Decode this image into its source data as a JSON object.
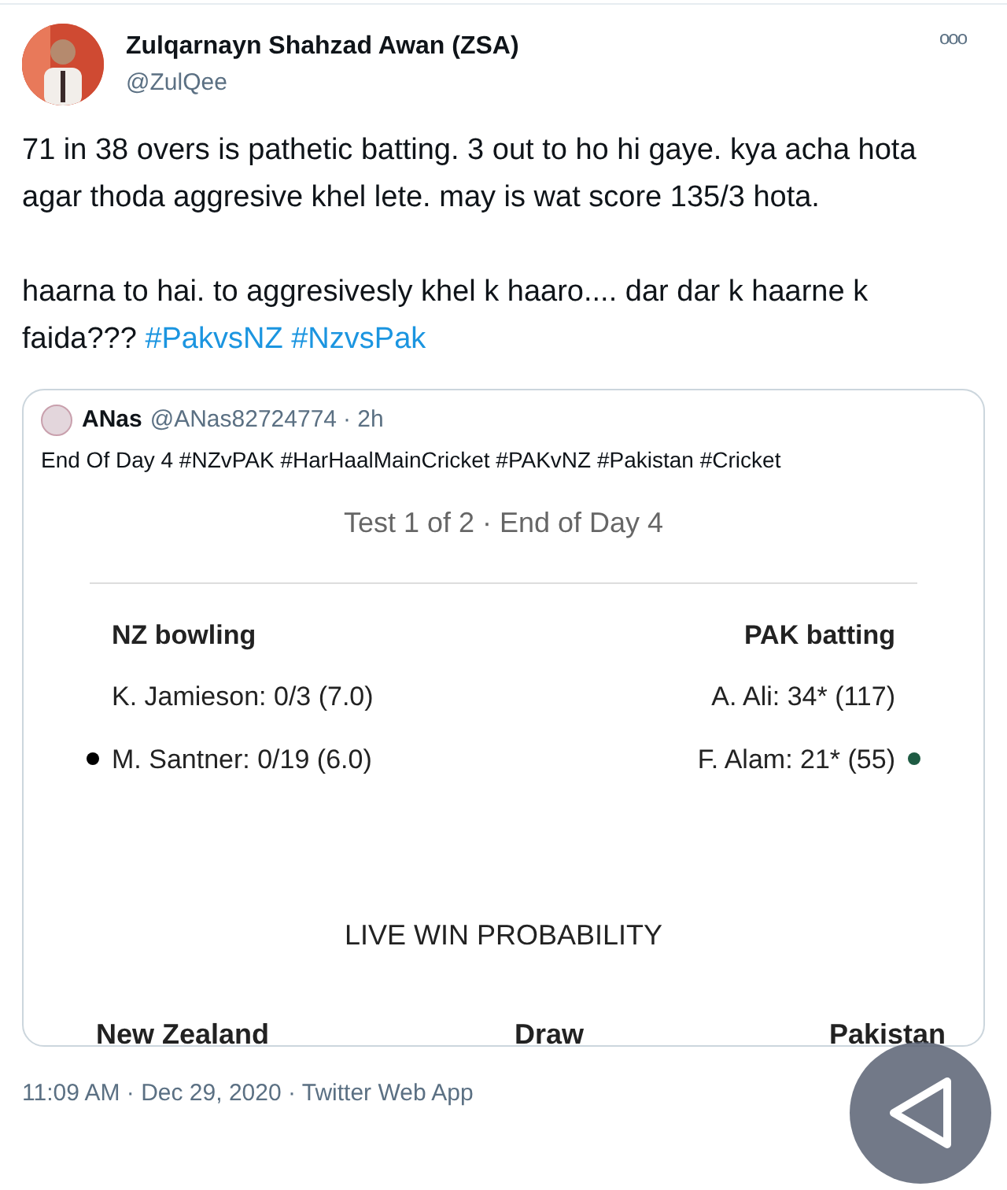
{
  "author": {
    "name": "Zulqarnayn Shahzad Awan (ZSA)",
    "handle": "@ZulQee"
  },
  "more": "ooo",
  "body": [
    {
      "text": "71 in 38 overs is pathetic batting. 3 out to ho hi gaye. kya acha hota agar thoda aggresive khel lete. may is wat score 135/3 hota."
    },
    {
      "text": "haarna to hai. to aggresivesly khel k haaro.... dar dar k haarne k faida???",
      "hashtags": [
        "#PakvsNZ",
        "#NzvsPak"
      ]
    }
  ],
  "quoted": {
    "name": "ANas",
    "handle": "@ANas82724774",
    "time": "· 2h",
    "text": "End Of Day 4 #NZvPAK #HarHaalMainCricket #PAKvNZ #Pakistan #Cricket",
    "match": {
      "title": "Test 1 of 2 · End of Day 4",
      "bowling": {
        "heading": "NZ bowling",
        "players": [
          {
            "line": "K. Jamieson: 0/3 (7.0)",
            "current": false
          },
          {
            "line": "M. Santner: 0/19 (6.0)",
            "current": true
          }
        ]
      },
      "batting": {
        "heading": "PAK batting",
        "players": [
          {
            "line": "A. Ali: 34* (117)",
            "current": false
          },
          {
            "line": "F. Alam: 21* (55)",
            "current": true
          }
        ]
      },
      "probability_title": "LIVE WIN PROBABILITY",
      "teams": [
        "New Zealand",
        "Draw",
        "Pakistan"
      ]
    }
  },
  "timestamp": "11:09 AM · Dec 29, 2020 · Twitter Web App"
}
